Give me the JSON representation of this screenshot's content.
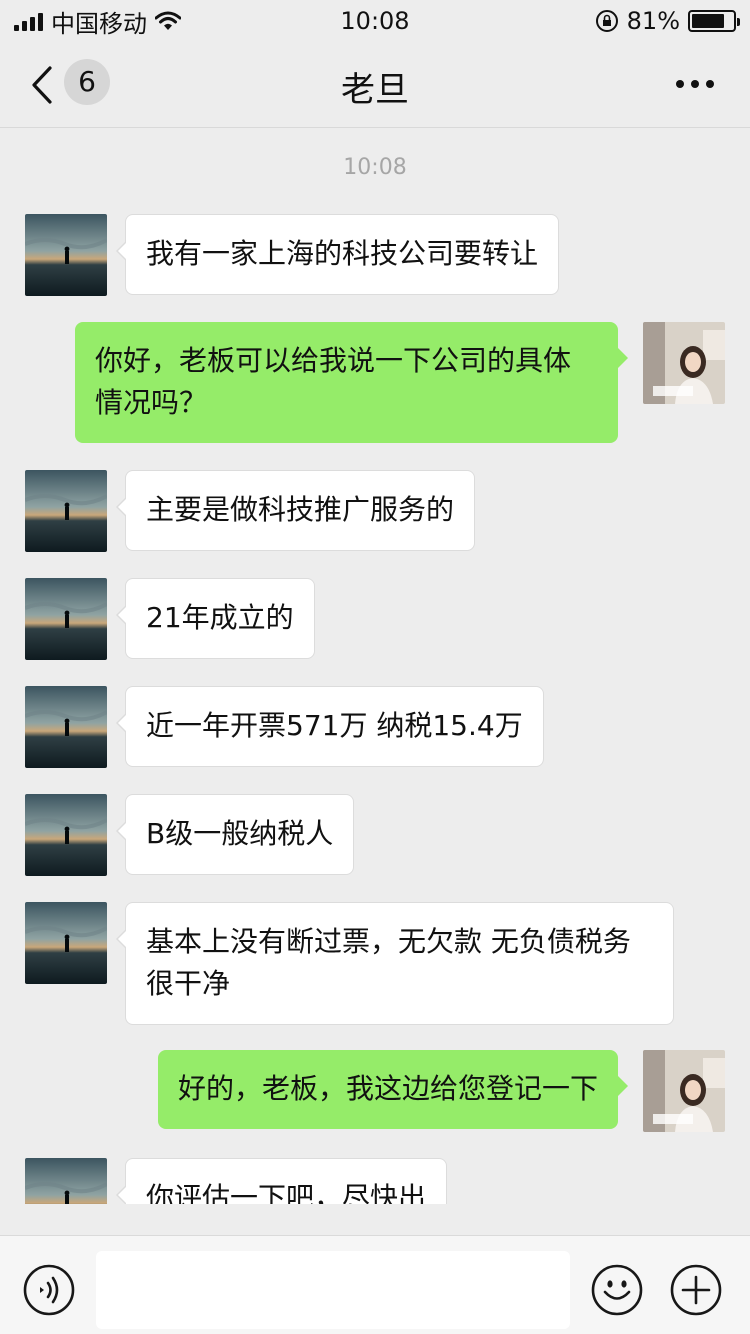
{
  "status_bar": {
    "carrier": "中国移动",
    "time": "10:08",
    "battery_text": "81%",
    "battery_level": 0.81,
    "icons": [
      "signal-icon",
      "wifi-icon",
      "orientation-lock-icon",
      "battery-icon"
    ]
  },
  "nav": {
    "back_icon": "chevron-left-icon",
    "unread_count": "6",
    "title": "老旦",
    "more_icon": "more-dots-icon"
  },
  "chat": {
    "timestamp": "10:08",
    "messages": [
      {
        "from": "them",
        "text": "我有一家上海的科技公司要转让"
      },
      {
        "from": "me",
        "text": "你好，老板可以给我说一下公司的具体情况吗？"
      },
      {
        "from": "them",
        "text": "主要是做科技推广服务的"
      },
      {
        "from": "them",
        "text": "21年成立的"
      },
      {
        "from": "them",
        "text": "近一年开票571万 纳税15.4万"
      },
      {
        "from": "them",
        "text": "B级一般纳税人"
      },
      {
        "from": "them",
        "text": "基本上没有断过票，无欠款 无负债税务很干净"
      },
      {
        "from": "me",
        "text": "好的，老板，我这边给您登记一下"
      },
      {
        "from": "them",
        "text": "你评估一下吧，尽快出"
      }
    ]
  },
  "input_bar": {
    "voice_icon": "voice-icon",
    "text_value": "",
    "emoji_icon": "emoji-icon",
    "plus_icon": "plus-icon"
  },
  "colors": {
    "background": "#ededed",
    "outgoing_bubble": "#95ec69",
    "incoming_bubble": "#ffffff"
  }
}
